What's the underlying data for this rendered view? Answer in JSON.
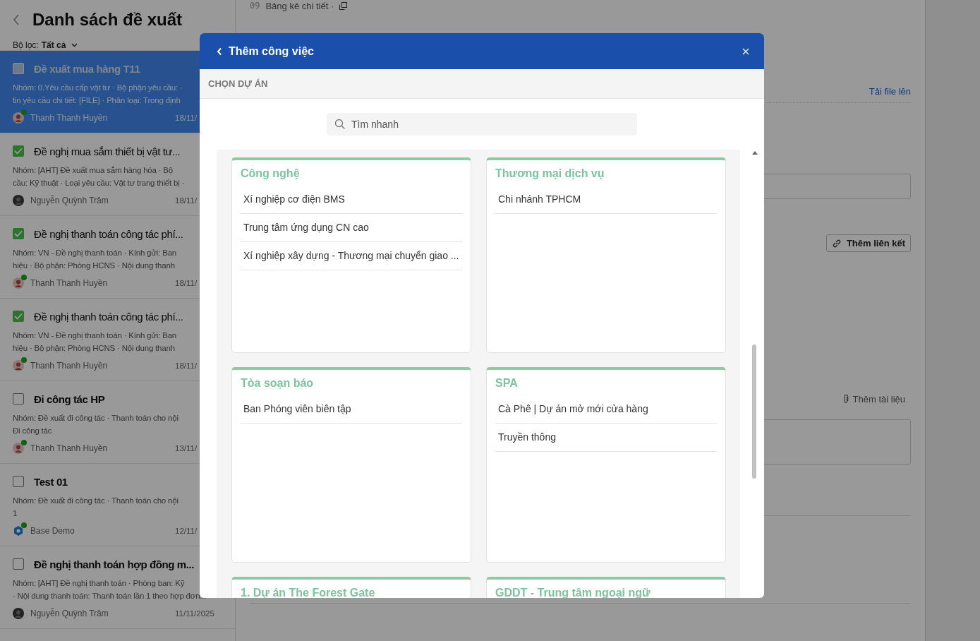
{
  "list_header": {
    "title": "Danh sách đề xuất",
    "filter_label": "Bộ lọc:",
    "filter_value": "Tất cả"
  },
  "proposals": [
    {
      "title": "Đề xuất mua hàng T11",
      "selected": true,
      "checked": false,
      "description": [
        "Nhóm: 0.Yêu cầu cấp vật tư · Bộ phận yêu cầu: ·",
        "tin yêu cầu chi tiết: [FILE] · Phân loại: Trong định"
      ],
      "author": "Thanh Thanh Huyền",
      "kind": "person",
      "online": true,
      "date": "18/11/"
    },
    {
      "title": "Đề nghị mua sắm thiết bị vật tư...",
      "selected": false,
      "checked": true,
      "description": [
        "Nhóm: [AHT] Đề xuất mua sắm hàng hóa · Bộ",
        "cầu: Kỹ thuật · Loại yêu cầu: Vật tư trang thiết bị ·"
      ],
      "author": "Nguyễn Quỳnh Trâm",
      "kind": "dark",
      "online": false,
      "date": "18/11/"
    },
    {
      "title": "Đề nghị thanh toán công tác phí...",
      "selected": false,
      "checked": true,
      "description": [
        "Nhóm: VN - Đề nghị thanh toán · Kính gửi: Ban",
        "hiệu · Bộ phận: Phòng HCNS · Nội dung thanh"
      ],
      "author": "Thanh Thanh Huyền",
      "kind": "person",
      "online": true,
      "date": "18/11/"
    },
    {
      "title": "Đề nghị thanh toán công tác phí...",
      "selected": false,
      "checked": true,
      "description": [
        "Nhóm: VN - Đề nghị thanh toán · Kính gửi: Ban",
        "hiệu · Bộ phận: Phòng HCNS · Nội dung thanh"
      ],
      "author": "Thanh Thanh Huyền",
      "kind": "person",
      "online": true,
      "date": "18/11/"
    },
    {
      "title": "Đi công tác HP",
      "selected": false,
      "checked": false,
      "description": [
        "Nhóm: Đề xuất đi công tác · Thanh toán cho nội",
        "Đi công tác"
      ],
      "author": "Thanh Thanh Huyền",
      "kind": "person",
      "online": true,
      "date": "13/11/"
    },
    {
      "title": "Test 01",
      "selected": false,
      "checked": false,
      "description": [
        "Nhóm: Đề xuất đi công tác · Thanh toán cho nội",
        "1"
      ],
      "author": "Base Demo",
      "kind": "logo",
      "online": true,
      "date": "12/11/"
    },
    {
      "title": "Đề nghị thanh toán hợp đồng m...",
      "selected": false,
      "checked": false,
      "description": [
        "Nhóm: [AHT] Đề nghị thanh toán · Phòng ban: Kỹ",
        "· Nội dung thanh toán: Thanh toán lần 1 theo hợp đơn..."
      ],
      "author": "Nguyễn Quỳnh Trâm",
      "kind": "dark",
      "online": false,
      "date": "11/11/2025"
    }
  ],
  "detail": {
    "row_number": "09",
    "row_label": "Bảng kê chi tiết ·",
    "upload_link": "Tải file lên",
    "add_link_button": "Thêm liên kết",
    "add_document": "Thêm tài liệu"
  },
  "modal": {
    "title": "Thêm công việc",
    "section_label": "CHỌN DỰ ÁN",
    "search": {
      "placeholder": "Tìm nhanh"
    },
    "groups": [
      {
        "title": "Công nghệ",
        "projects": [
          "Xí nghiệp cơ điện BMS",
          "Trung tâm ứng dụng CN cao",
          "Xí nghiệp xây dựng - Thương mại chuyển giao ..."
        ]
      },
      {
        "title": "Thương mại dịch vụ",
        "projects": [
          "Chi nhánh TPHCM"
        ]
      },
      {
        "title": "Tòa soạn báo",
        "projects": [
          "Ban Phóng viên biên tập"
        ]
      },
      {
        "title": "SPA",
        "projects": [
          "Cà Phê | Dự án mở mới cửa hàng",
          "Truyền thông"
        ]
      },
      {
        "title": "1. Dự án The Forest Gate"
      },
      {
        "title": "GDDT - Trung tâm ngoại ngữ"
      }
    ]
  }
}
